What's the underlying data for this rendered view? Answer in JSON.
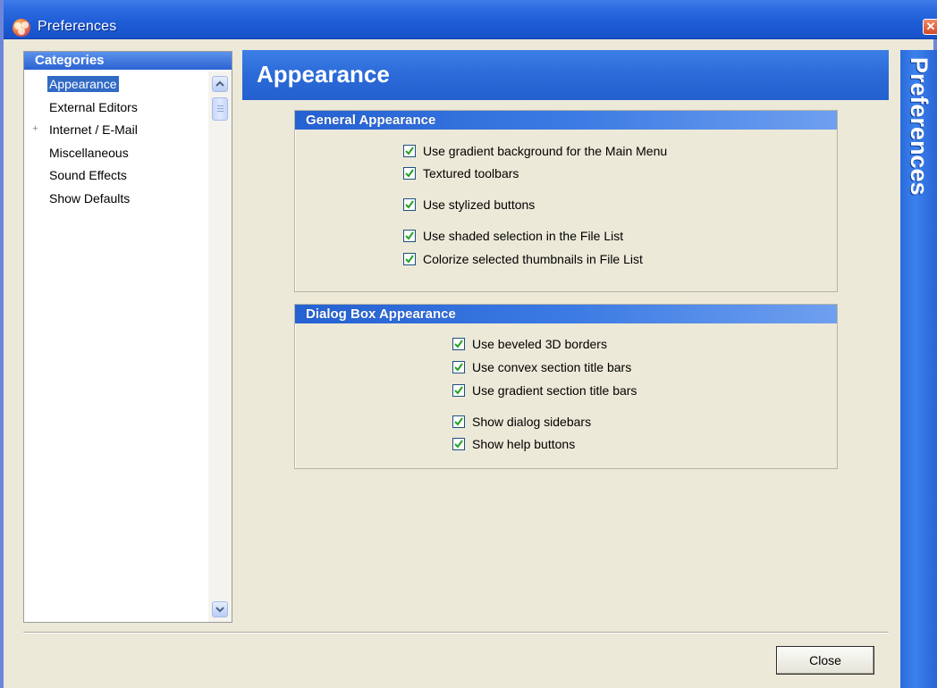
{
  "window": {
    "title": "Preferences",
    "close_glyph": "✕"
  },
  "categories": {
    "header": "Categories",
    "items": [
      {
        "label": "Appearance",
        "selected": true,
        "expandable": false
      },
      {
        "label": "External Editors",
        "selected": false,
        "expandable": false
      },
      {
        "label": "Internet / E-Mail",
        "selected": false,
        "expandable": true
      },
      {
        "label": "Miscellaneous",
        "selected": false,
        "expandable": false
      },
      {
        "label": "Sound Effects",
        "selected": false,
        "expandable": false
      },
      {
        "label": "Show Defaults",
        "selected": false,
        "expandable": false
      }
    ],
    "expander_glyph": "+"
  },
  "page": {
    "title": "Appearance"
  },
  "sections": {
    "general": {
      "title": "General Appearance",
      "options": [
        {
          "label": "Use gradient background for the Main Menu",
          "checked": true
        },
        {
          "label": "Textured toolbars",
          "checked": true
        },
        {
          "label": "Use stylized buttons",
          "checked": true
        },
        {
          "label": "Use shaded selection in the File List",
          "checked": true
        },
        {
          "label": "Colorize selected thumbnails in File List",
          "checked": true
        }
      ]
    },
    "dialog": {
      "title": "Dialog Box Appearance",
      "options": [
        {
          "label": "Use beveled 3D borders",
          "checked": true
        },
        {
          "label": "Use convex section title bars",
          "checked": true
        },
        {
          "label": "Use gradient section title bars",
          "checked": true
        },
        {
          "label": "Show dialog sidebars",
          "checked": true
        },
        {
          "label": "Show help buttons",
          "checked": true
        }
      ]
    }
  },
  "footer": {
    "close_label": "Close"
  },
  "sidebar": {
    "text": "Preferences"
  },
  "colors": {
    "title_bar": "#1e5cd6",
    "selection": "#316ac5",
    "dialog_face": "#ece9d8"
  }
}
